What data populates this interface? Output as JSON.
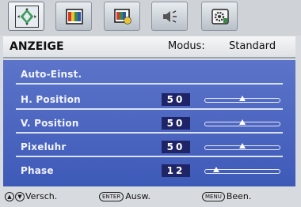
{
  "tabs": [
    {
      "icon": "display-settings-icon",
      "active": true
    },
    {
      "icon": "picture-icon",
      "active": false
    },
    {
      "icon": "picture-advanced-icon",
      "active": false
    },
    {
      "icon": "audio-icon",
      "active": false
    },
    {
      "icon": "system-settings-icon",
      "active": false
    }
  ],
  "header": {
    "title": "ANZEIGE",
    "mode_label": "Modus:",
    "mode_value": "Standard"
  },
  "menu": [
    {
      "label": "Auto-Einst."
    },
    {
      "label": "H. Position",
      "value": "50",
      "level": 50
    },
    {
      "label": "V. Position",
      "value": "50",
      "level": 50
    },
    {
      "label": "Pixeluhr",
      "value": "50",
      "level": 50
    },
    {
      "label": "Phase",
      "value": "12",
      "level": 12
    }
  ],
  "footer": {
    "move_label": "Versch.",
    "enter_key": "ENTER",
    "enter_label": "Ausw.",
    "menu_key": "MENU",
    "menu_label": "Been."
  },
  "colors": {
    "panel": "#4a63bf",
    "value_box": "#1e2466"
  }
}
